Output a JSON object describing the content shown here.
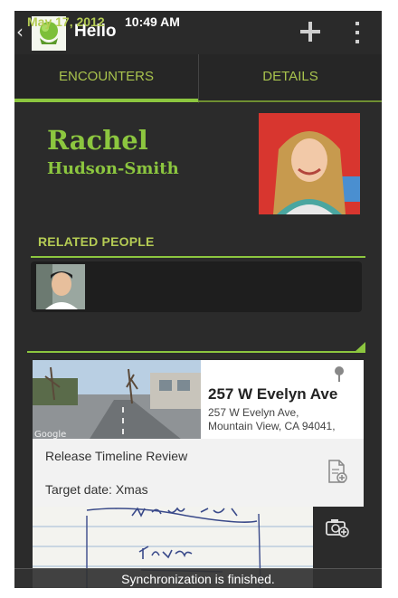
{
  "action_bar": {
    "back_glyph": "‹",
    "title": "Hello",
    "app_icon": "contacts-app-icon",
    "add_icon": "add-icon",
    "overflow_icon": "more-vertical-icon"
  },
  "tabs": [
    {
      "label": "ENCOUNTERS",
      "selected": true
    },
    {
      "label": "DETAILS",
      "selected": false
    }
  ],
  "contact": {
    "first_name": "Rachel",
    "last_name": "Hudson-Smith",
    "photo": "contact-photo"
  },
  "related_people": {
    "header": "RELATED PEOPLE",
    "people": [
      {
        "avatar": "related-person-avatar"
      }
    ]
  },
  "encounter": {
    "date": "May 17, 2012",
    "time": "10:49 AM",
    "location": {
      "map_label": "Google",
      "title": "257 W Evelyn Ave",
      "line1": "257 W Evelyn Ave,",
      "line2": "Mountain View, CA 94041,",
      "pin_icon": "map-pin-icon"
    },
    "task": {
      "title": "Release Timeline Review",
      "target": "Target date: Xmas",
      "icon": "add-document-icon"
    },
    "camera_icon": "add-photo-icon"
  },
  "toast": {
    "text": "Synchronization is finished."
  },
  "colors": {
    "accent": "#8cc63f",
    "background": "#2b2b2b"
  }
}
